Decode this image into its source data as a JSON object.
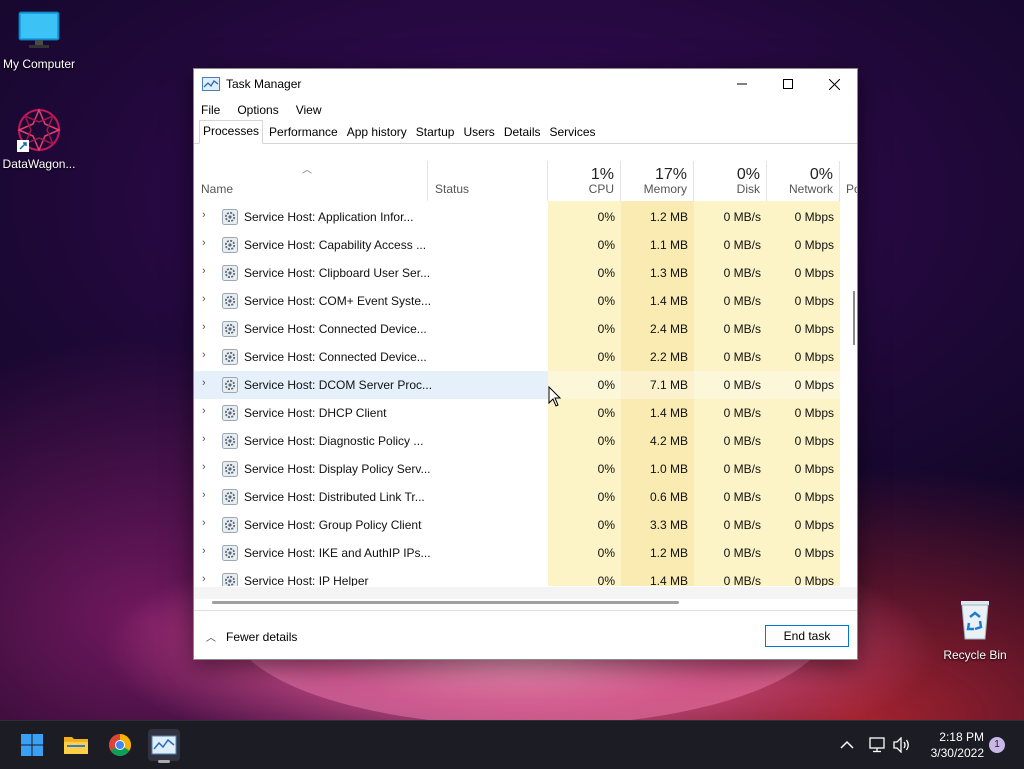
{
  "desktop": {
    "icons": [
      {
        "label": "My Computer"
      },
      {
        "label": "DataWagon..."
      },
      {
        "label": "Recycle Bin"
      }
    ]
  },
  "window": {
    "title": "Task Manager",
    "menu": [
      "File",
      "Options",
      "View"
    ],
    "tabs": [
      "Processes",
      "Performance",
      "App history",
      "Startup",
      "Users",
      "Details",
      "Services"
    ],
    "active_tab": "Processes"
  },
  "columns": {
    "name": "Name",
    "status": "Status",
    "cpu": {
      "pct": "1%",
      "label": "CPU"
    },
    "memory": {
      "pct": "17%",
      "label": "Memory"
    },
    "disk": {
      "pct": "0%",
      "label": "Disk"
    },
    "network": {
      "pct": "0%",
      "label": "Network"
    },
    "power": "Po"
  },
  "rows": [
    {
      "name": "Service Host: Application Infor...",
      "cpu": "0%",
      "memory": "1.2 MB",
      "disk": "0 MB/s",
      "network": "0 Mbps"
    },
    {
      "name": "Service Host: Capability Access ...",
      "cpu": "0%",
      "memory": "1.1 MB",
      "disk": "0 MB/s",
      "network": "0 Mbps"
    },
    {
      "name": "Service Host: Clipboard User Ser...",
      "cpu": "0%",
      "memory": "1.3 MB",
      "disk": "0 MB/s",
      "network": "0 Mbps"
    },
    {
      "name": "Service Host: COM+ Event Syste...",
      "cpu": "0%",
      "memory": "1.4 MB",
      "disk": "0 MB/s",
      "network": "0 Mbps"
    },
    {
      "name": "Service Host: Connected Device...",
      "cpu": "0%",
      "memory": "2.4 MB",
      "disk": "0 MB/s",
      "network": "0 Mbps"
    },
    {
      "name": "Service Host: Connected Device...",
      "cpu": "0%",
      "memory": "2.2 MB",
      "disk": "0 MB/s",
      "network": "0 Mbps"
    },
    {
      "name": "Service Host: DCOM Server Proc...",
      "cpu": "0%",
      "memory": "7.1 MB",
      "disk": "0 MB/s",
      "network": "0 Mbps"
    },
    {
      "name": "Service Host: DHCP Client",
      "cpu": "0%",
      "memory": "1.4 MB",
      "disk": "0 MB/s",
      "network": "0 Mbps"
    },
    {
      "name": "Service Host: Diagnostic Policy ...",
      "cpu": "0%",
      "memory": "4.2 MB",
      "disk": "0 MB/s",
      "network": "0 Mbps"
    },
    {
      "name": "Service Host: Display Policy Serv...",
      "cpu": "0%",
      "memory": "1.0 MB",
      "disk": "0 MB/s",
      "network": "0 Mbps"
    },
    {
      "name": "Service Host: Distributed Link Tr...",
      "cpu": "0%",
      "memory": "0.6 MB",
      "disk": "0 MB/s",
      "network": "0 Mbps"
    },
    {
      "name": "Service Host: Group Policy Client",
      "cpu": "0%",
      "memory": "3.3 MB",
      "disk": "0 MB/s",
      "network": "0 Mbps"
    },
    {
      "name": "Service Host: IKE and AuthIP IPs...",
      "cpu": "0%",
      "memory": "1.2 MB",
      "disk": "0 MB/s",
      "network": "0 Mbps"
    },
    {
      "name": "Service Host: IP Helper",
      "cpu": "0%",
      "memory": "1.4 MB",
      "disk": "0 MB/s",
      "network": "0 Mbps"
    }
  ],
  "footer": {
    "fewer_details": "Fewer details",
    "end_task": "End task"
  },
  "taskbar": {
    "time": "2:18 PM",
    "date": "3/30/2022",
    "notifications": "1"
  },
  "colors": {
    "cpu_col": "#fbf2c4",
    "memory_col": "#f9eab0",
    "accent": "#0078d4",
    "selected_row": "#e5f0fa"
  }
}
